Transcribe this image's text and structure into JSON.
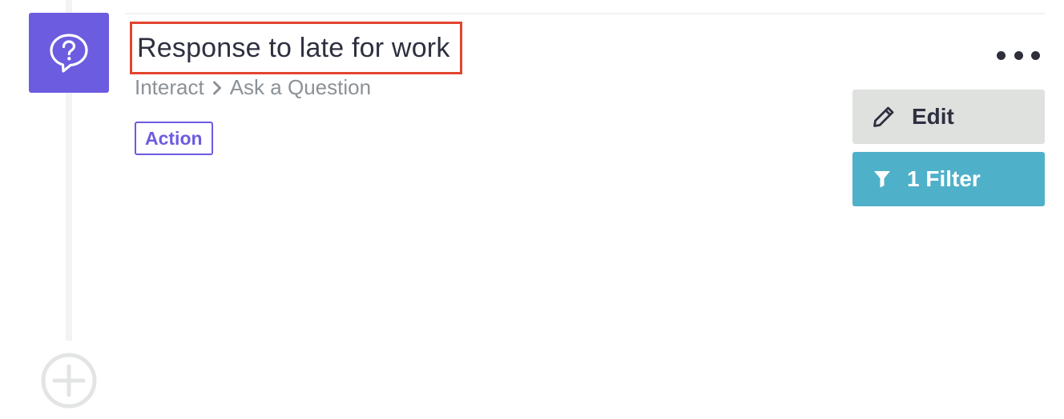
{
  "step": {
    "title": "Response to late for work",
    "icon": "question-chat-icon",
    "breadcrumb": {
      "app": "Interact",
      "separator_icon": "chevron-right-icon",
      "action": "Ask a Question"
    },
    "tag": "Action"
  },
  "actions": {
    "more_icon": "more-horizontal-icon",
    "edit_label": "Edit",
    "edit_icon": "pencil-icon",
    "filter_label": "1 Filter",
    "filter_icon": "funnel-icon"
  },
  "add_step_icon": "plus-circle-icon",
  "colors": {
    "step_accent": "#6c5ce0",
    "highlight_border": "#e2452e",
    "edit_bg": "#dfe1df",
    "filter_bg": "#4fb0c9",
    "timeline": "#f2f3f3"
  }
}
